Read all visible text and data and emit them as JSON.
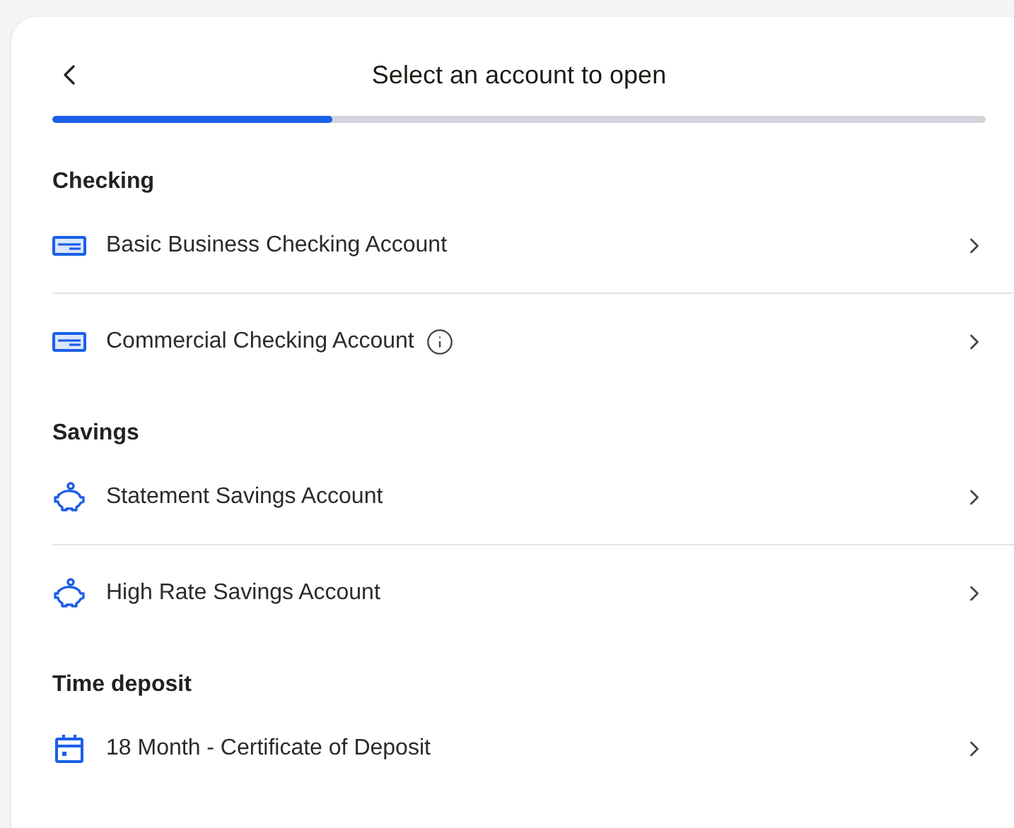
{
  "header": {
    "title": "Select an account to open"
  },
  "progress": {
    "level": 0.3
  },
  "sections": [
    {
      "heading": "Checking",
      "items": [
        {
          "kind": "card",
          "label": "Basic Business Checking Account",
          "info": false
        },
        {
          "kind": "card",
          "label": "Commercial Checking Account",
          "info": true
        }
      ]
    },
    {
      "heading": "Savings",
      "items": [
        {
          "kind": "piggy",
          "label": "Statement Savings Account",
          "info": false
        },
        {
          "kind": "piggy",
          "label": "High Rate Savings Account",
          "info": false
        }
      ]
    },
    {
      "heading": "Time deposit",
      "items": [
        {
          "kind": "calendar",
          "label": "18 Month - Certificate of Deposit",
          "info": false
        }
      ]
    }
  ]
}
